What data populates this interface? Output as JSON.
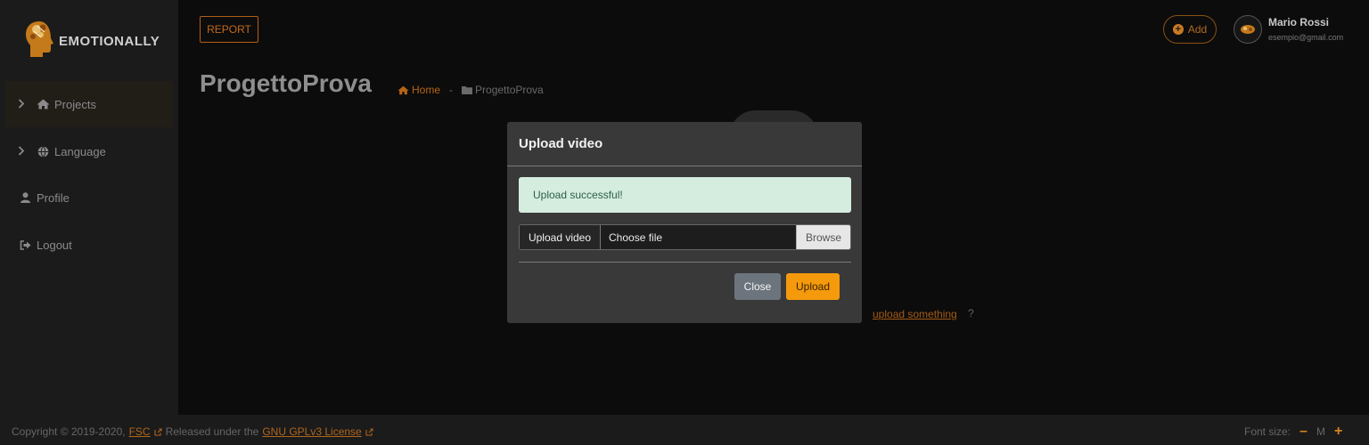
{
  "brand": {
    "name": "EMOTIONALLY"
  },
  "sidebar": {
    "items": [
      {
        "label": "Projects",
        "icon": "home-icon",
        "has_arrow": true,
        "active": true
      },
      {
        "label": "Language",
        "icon": "globe-icon",
        "has_arrow": true,
        "active": false
      },
      {
        "label": "Profile",
        "icon": "user-icon",
        "has_arrow": false,
        "active": false
      },
      {
        "label": "Logout",
        "icon": "logout-icon",
        "has_arrow": false,
        "active": false
      }
    ]
  },
  "header": {
    "report_label": "REPORT",
    "add_label": "Add",
    "user": {
      "name": "Mario Rossi",
      "email": "esempio@gmail.com"
    }
  },
  "page": {
    "title": "ProgettoProva",
    "breadcrumb": {
      "home": "Home",
      "separator": "-",
      "current": "ProgettoProva"
    },
    "hint_link": "upload something",
    "hint_q": "?"
  },
  "modal": {
    "title": "Upload video",
    "alert": "Upload successful!",
    "file_label": "Upload video",
    "file_placeholder": "Choose file",
    "browse_label": "Browse",
    "close_label": "Close",
    "upload_label": "Upload"
  },
  "footer": {
    "copyright": "Copyright © 2019-2020,",
    "fsc_link": "FSC",
    "released": "Released under the",
    "license_link": "GNU GPLv3 License",
    "font_size_label": "Font size:",
    "font_minus": "–",
    "font_current": "M",
    "font_plus": "+"
  },
  "colors": {
    "accent": "#f59a0c",
    "accent_dark": "#b86416",
    "alert_bg": "#d4eddf",
    "modal_bg": "#393939",
    "sidebar_bg": "#1b1b1b"
  }
}
